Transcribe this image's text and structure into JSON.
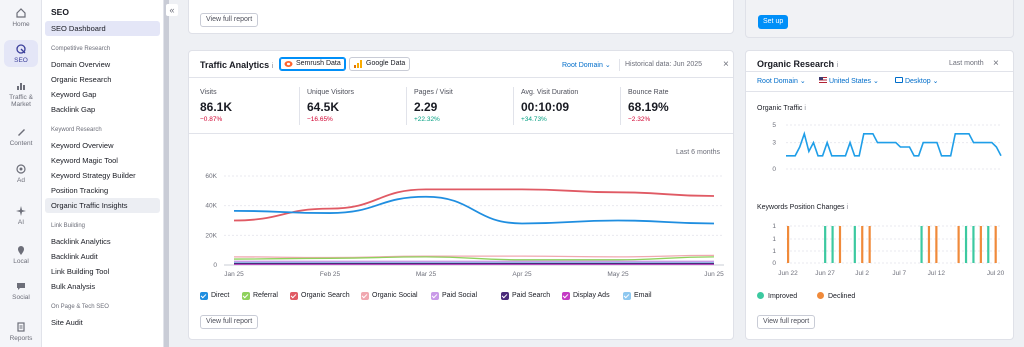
{
  "rail": [
    {
      "name": "home",
      "label": "Home"
    },
    {
      "name": "seo",
      "label": "SEO"
    },
    {
      "name": "traffic-market",
      "label": "Traffic & Market"
    },
    {
      "name": "content",
      "label": "Content"
    },
    {
      "name": "ad",
      "label": "Ad"
    },
    {
      "name": "ai",
      "label": "AI"
    },
    {
      "name": "local",
      "label": "Local"
    },
    {
      "name": "social",
      "label": "Social"
    },
    {
      "name": "reports",
      "label": "Reports"
    }
  ],
  "sidebar": {
    "title": "SEO",
    "collapse_icon": "«",
    "dashboard": "SEO Dashboard",
    "sections": [
      {
        "heading": "Competitive Research",
        "items": [
          "Domain Overview",
          "Organic Research",
          "Keyword Gap",
          "Backlink Gap"
        ]
      },
      {
        "heading": "Keyword Research",
        "items": [
          "Keyword Overview",
          "Keyword Magic Tool",
          "Keyword Strategy Builder",
          "Position Tracking",
          "Organic Traffic Insights"
        ]
      },
      {
        "heading": "Link Building",
        "items": [
          "Backlink Analytics",
          "Backlink Audit",
          "Link Building Tool",
          "Bulk Analysis"
        ]
      },
      {
        "heading": "On Page & Tech SEO",
        "items": [
          "Site Audit"
        ]
      }
    ]
  },
  "top": {
    "view_full_report": "View full report",
    "setup": "Set up"
  },
  "traffic": {
    "title": "Traffic Analytics",
    "info": "i",
    "tabs": [
      "Semrush Data",
      "Google Data"
    ],
    "root_domain": "Root Domain",
    "historical": "Historical data: Jun 2025",
    "metrics": [
      {
        "label": "Visits",
        "value": "86.1K",
        "delta": "−0.87%",
        "dir": "neg"
      },
      {
        "label": "Unique Visitors",
        "value": "64.5K",
        "delta": "−16.65%",
        "dir": "neg"
      },
      {
        "label": "Pages / Visit",
        "value": "2.29",
        "delta": "+22.32%",
        "dir": "pos"
      },
      {
        "label": "Avg. Visit Duration",
        "value": "00:10:09",
        "delta": "+34.73%",
        "dir": "pos"
      },
      {
        "label": "Bounce Rate",
        "value": "68.19%",
        "delta": "−2.32%",
        "dir": "neg"
      }
    ],
    "period": "Last 6 months",
    "legend": [
      {
        "label": "Direct",
        "color": "#1f8ee0"
      },
      {
        "label": "Referral",
        "color": "#8fd15c"
      },
      {
        "label": "Organic Search",
        "color": "#e05a64"
      },
      {
        "label": "Organic Social",
        "color": "#f0a8b0"
      },
      {
        "label": "Paid Social",
        "color": "#c99ae8"
      },
      {
        "label": "Paid Search",
        "color": "#4a2a7a"
      },
      {
        "label": "Display Ads",
        "color": "#c43ac4"
      },
      {
        "label": "Email",
        "color": "#8ec8f0"
      }
    ],
    "view_full_report": "View full report"
  },
  "organic": {
    "title": "Organic Research",
    "info": "i",
    "period": "Last month",
    "close": "×",
    "filters": {
      "root_domain": "Root Domain",
      "country": "United States",
      "device": "Desktop"
    },
    "traffic_label": "Organic Traffic",
    "kpc_label": "Keywords Position Changes",
    "legend": [
      {
        "label": "Improved",
        "color": "#3cc9a0"
      },
      {
        "label": "Declined",
        "color": "#f08a3a"
      }
    ],
    "view_full_report": "View full report"
  },
  "chart_data": [
    {
      "type": "line",
      "title": "Traffic Analytics",
      "x": [
        "Jan 25",
        "Feb 25",
        "Mar 25",
        "Apr 25",
        "May 25",
        "Jun 25"
      ],
      "ylim": [
        0,
        60000
      ],
      "yticks": [
        "0",
        "20K",
        "40K",
        "60K"
      ],
      "series": [
        {
          "name": "Direct",
          "color": "#1f8ee0",
          "values": [
            36500,
            35000,
            46000,
            28000,
            30000,
            28000
          ]
        },
        {
          "name": "Organic Search",
          "color": "#e05a64",
          "values": [
            30000,
            38000,
            51000,
            51000,
            49000,
            46500
          ]
        },
        {
          "name": "Referral",
          "color": "#8fd15c",
          "values": [
            4000,
            4500,
            5500,
            3500,
            3500,
            5500
          ]
        },
        {
          "name": "Organic Social",
          "color": "#f0a8b0",
          "values": [
            5500,
            5000,
            6000,
            6000,
            5500,
            6500
          ]
        },
        {
          "name": "Paid Social",
          "color": "#c99ae8",
          "values": [
            2500,
            2500,
            2500,
            2500,
            2500,
            2500
          ]
        },
        {
          "name": "Paid Search",
          "color": "#4a2a7a",
          "values": [
            1000,
            1000,
            1000,
            1000,
            1000,
            1000
          ]
        },
        {
          "name": "Display Ads",
          "color": "#c43ac4",
          "values": [
            500,
            500,
            500,
            500,
            500,
            500
          ]
        },
        {
          "name": "Email",
          "color": "#8ec8f0",
          "values": [
            1500,
            1500,
            1500,
            1500,
            1500,
            1500
          ]
        }
      ]
    },
    {
      "type": "line",
      "title": "Organic Traffic",
      "yticks": [
        "0",
        "3",
        "5"
      ],
      "ylim": [
        0,
        5
      ],
      "values": [
        1.5,
        1.5,
        1.5,
        2.5,
        4,
        2,
        3,
        1.5,
        1.5,
        3,
        1.5,
        1.5,
        1.5,
        1.5,
        3,
        1.5,
        1.5,
        4,
        4,
        4,
        3,
        3,
        3,
        3,
        3,
        2.5,
        2.5,
        2.5,
        1.5,
        1.5,
        3,
        3,
        3,
        3,
        1.5,
        1.5,
        1.5,
        4,
        4,
        4,
        4,
        3,
        3,
        3,
        3,
        3,
        2.5,
        1.5
      ]
    },
    {
      "type": "bar",
      "title": "Keywords Position Changes",
      "x": [
        "Jun 22",
        "Jun 27",
        "Jul 2",
        "Jul 7",
        "Jul 12",
        "Jul 20"
      ],
      "yticks": [
        "0",
        "1",
        "1",
        "1"
      ],
      "ylim": [
        0,
        1
      ],
      "series": [
        {
          "name": "Improved",
          "color": "#3cc9a0",
          "day_index": [
            5,
            6,
            9,
            18,
            24,
            25,
            27
          ]
        },
        {
          "name": "Declined",
          "color": "#f08a3a",
          "day_index": [
            0,
            7,
            10,
            11,
            19,
            20,
            23,
            26,
            28
          ]
        }
      ]
    }
  ]
}
